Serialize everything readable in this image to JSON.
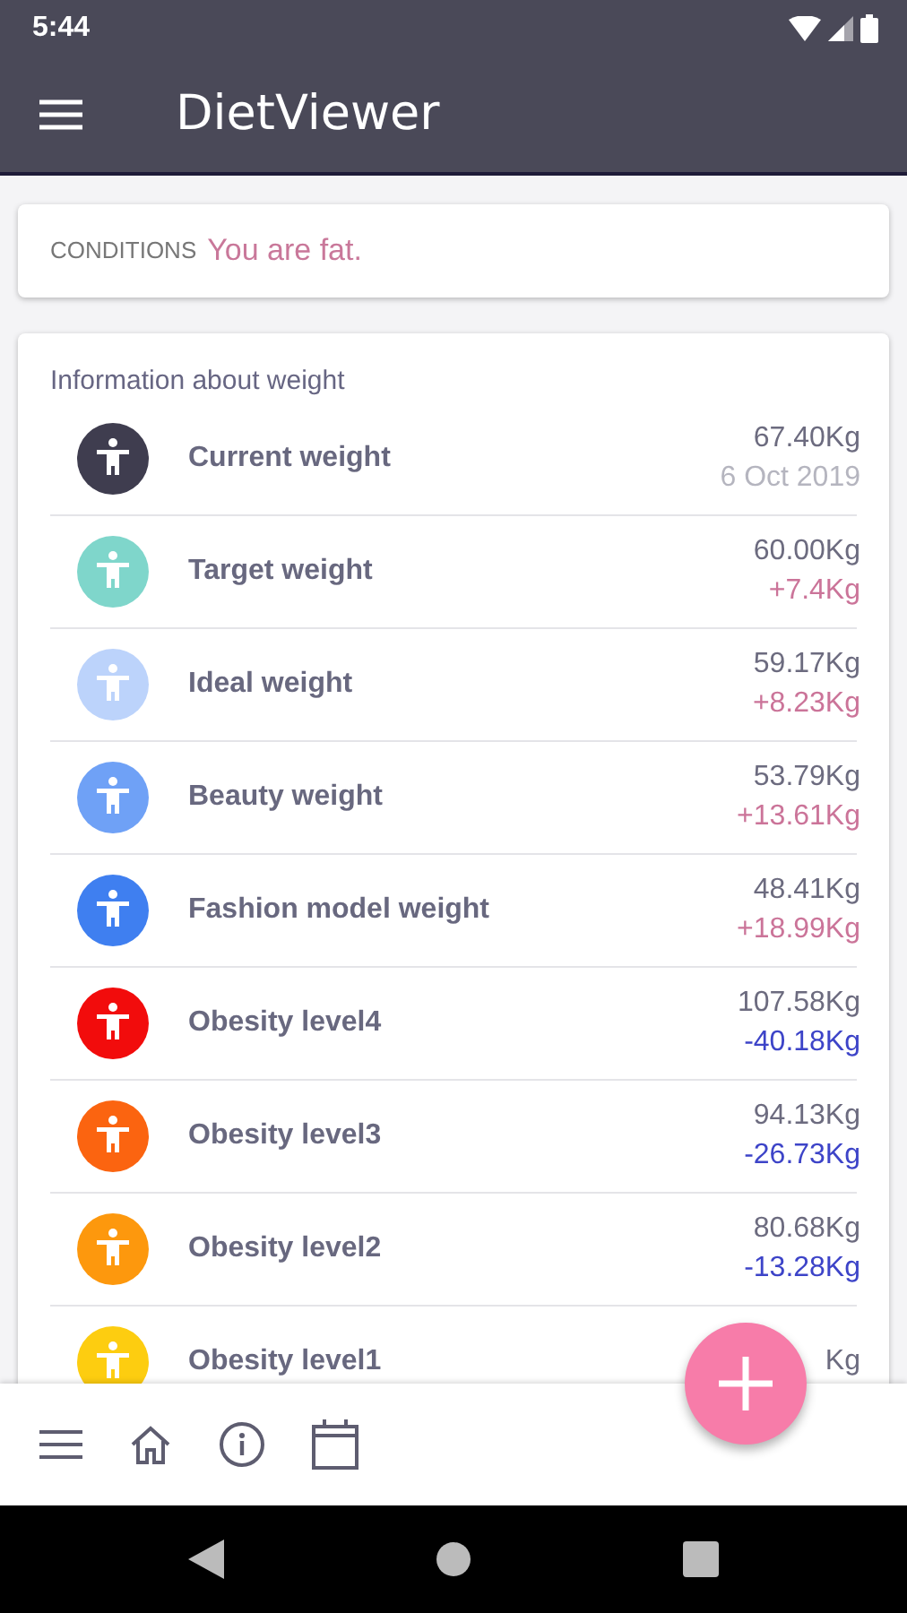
{
  "status_bar": {
    "time": "5:44"
  },
  "app_bar": {
    "title": "DietViewer"
  },
  "conditions": {
    "label": "CONDITIONS",
    "value": "You are fat."
  },
  "weight_card": {
    "title": "Information about weight",
    "rows": [
      {
        "name": "Current weight",
        "color": "#3f3d4f",
        "value": "67.40Kg",
        "detail": "6 Oct 2019",
        "kind": "date"
      },
      {
        "name": "Target weight",
        "color": "#7fd6cb",
        "value": "60.00Kg",
        "detail": "+7.4Kg",
        "kind": "gain"
      },
      {
        "name": "Ideal weight",
        "color": "#bcd3fb",
        "value": "59.17Kg",
        "detail": "+8.23Kg",
        "kind": "gain"
      },
      {
        "name": "Beauty weight",
        "color": "#6fa1f6",
        "value": "53.79Kg",
        "detail": "+13.61Kg",
        "kind": "gain"
      },
      {
        "name": "Fashion model weight",
        "color": "#3f7ff0",
        "value": "48.41Kg",
        "detail": "+18.99Kg",
        "kind": "gain"
      },
      {
        "name": "Obesity level4",
        "color": "#f20c0c",
        "value": "107.58Kg",
        "detail": "-40.18Kg",
        "kind": "loss"
      },
      {
        "name": "Obesity level3",
        "color": "#fb6410",
        "value": "94.13Kg",
        "detail": "-26.73Kg",
        "kind": "loss"
      },
      {
        "name": "Obesity level2",
        "color": "#fd980d",
        "value": "80.68Kg",
        "detail": "-13.28Kg",
        "kind": "loss"
      },
      {
        "name": "Obesity level1",
        "color": "#fdcd10",
        "value": "Kg"
      }
    ]
  }
}
